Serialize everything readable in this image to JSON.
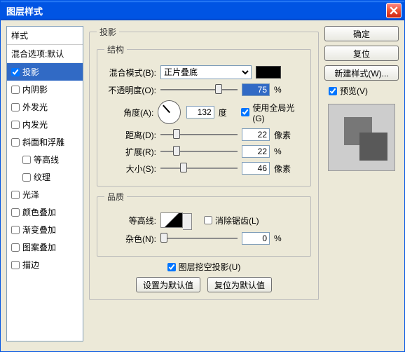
{
  "window": {
    "title": "图层样式"
  },
  "styles": {
    "header": "样式",
    "blendgroup": "混合选项:默认",
    "items": [
      {
        "key": "ds",
        "label": "投影",
        "checked": true,
        "selected": true
      },
      {
        "key": "innershadow",
        "label": "内阴影",
        "checked": false
      },
      {
        "key": "outerglow",
        "label": "外发光",
        "checked": false
      },
      {
        "key": "innerglow",
        "label": "内发光",
        "checked": false
      },
      {
        "key": "bevel",
        "label": "斜面和浮雕",
        "checked": false
      },
      {
        "key": "contour",
        "label": "等高线",
        "checked": false,
        "indent": true
      },
      {
        "key": "texture",
        "label": "纹理",
        "checked": false,
        "indent": true
      },
      {
        "key": "satin",
        "label": "光泽",
        "checked": false
      },
      {
        "key": "coloroverlay",
        "label": "颜色叠加",
        "checked": false
      },
      {
        "key": "gradoverlay",
        "label": "渐变叠加",
        "checked": false
      },
      {
        "key": "patoverlay",
        "label": "图案叠加",
        "checked": false
      },
      {
        "key": "stroke",
        "label": "描边",
        "checked": false
      }
    ]
  },
  "panel": {
    "title": "投影",
    "structure": {
      "legend": "结构",
      "blendmode_label": "混合模式(B):",
      "blendmode_value": "正片叠底",
      "color": "#000000",
      "opacity_label": "不透明度(O):",
      "opacity_value": "75",
      "opacity_unit": "%",
      "angle_label": "角度(A):",
      "angle_value": "132",
      "angle_unit": "度",
      "global_label": "使用全局光(G)",
      "global_checked": true,
      "distance_label": "距离(D):",
      "distance_value": "22",
      "distance_unit": "像素",
      "spread_label": "扩展(R):",
      "spread_value": "22",
      "spread_unit": "%",
      "size_label": "大小(S):",
      "size_value": "46",
      "size_unit": "像素"
    },
    "quality": {
      "legend": "品质",
      "contour_label": "等高线:",
      "antialias_label": "消除锯齿(L)",
      "antialias_checked": false,
      "noise_label": "杂色(N):",
      "noise_value": "0",
      "noise_unit": "%"
    },
    "knockout": {
      "label": "图层挖空投影(U)",
      "checked": true
    },
    "set_default": "设置为默认值",
    "reset_default": "复位为默认值"
  },
  "buttons": {
    "ok": "确定",
    "cancel": "复位",
    "newstyle": "新建样式(W)...",
    "preview_label": "预览(V)",
    "preview_checked": true
  }
}
